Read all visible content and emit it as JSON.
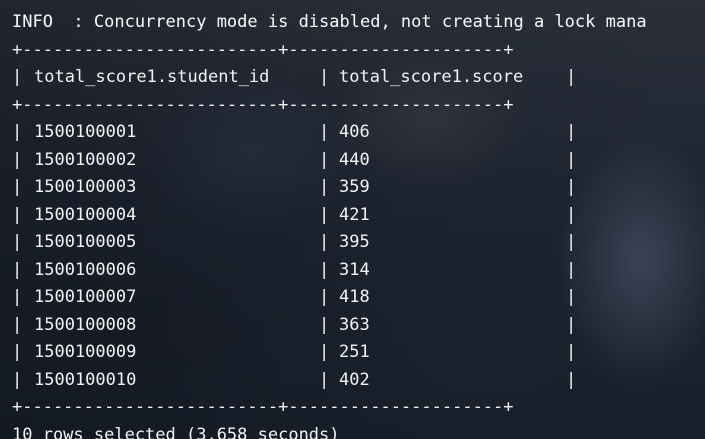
{
  "terminal": {
    "info_line": "INFO  : Concurrency mode is disabled, not creating a lock mana",
    "separator_line": "+-------------------------+---------------------+",
    "header": {
      "col1": "total_score1.student_id",
      "col2": "total_score1.score"
    },
    "rows": [
      {
        "student_id": "1500100001",
        "score": "406"
      },
      {
        "student_id": "1500100002",
        "score": "440"
      },
      {
        "student_id": "1500100003",
        "score": "359"
      },
      {
        "student_id": "1500100004",
        "score": "421"
      },
      {
        "student_id": "1500100005",
        "score": "395"
      },
      {
        "student_id": "1500100006",
        "score": "314"
      },
      {
        "student_id": "1500100007",
        "score": "418"
      },
      {
        "student_id": "1500100008",
        "score": "363"
      },
      {
        "student_id": "1500100009",
        "score": "251"
      },
      {
        "student_id": "1500100010",
        "score": "402"
      }
    ],
    "status_line": "10 rows selected (3.658 seconds)"
  }
}
